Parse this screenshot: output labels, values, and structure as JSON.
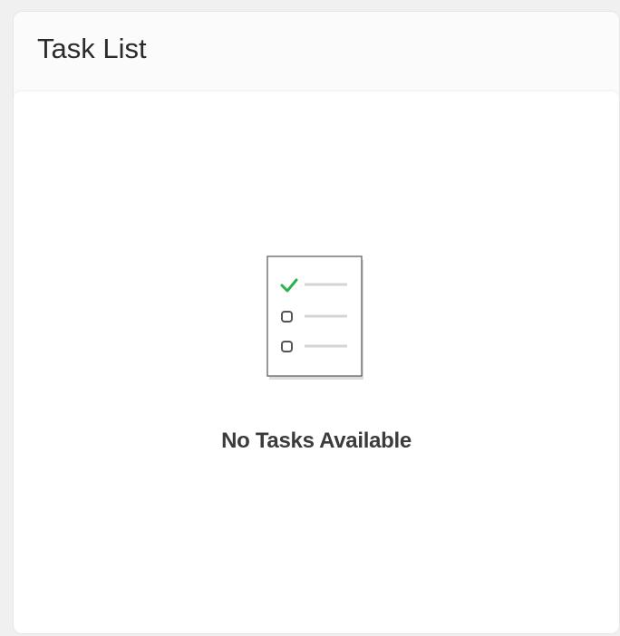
{
  "card": {
    "title": "Task List"
  },
  "empty_state": {
    "message": "No Tasks Available",
    "icon": "checklist-icon"
  },
  "colors": {
    "check": "#2db24c",
    "line": "#d5d5d5",
    "box_stroke": "#555555"
  }
}
